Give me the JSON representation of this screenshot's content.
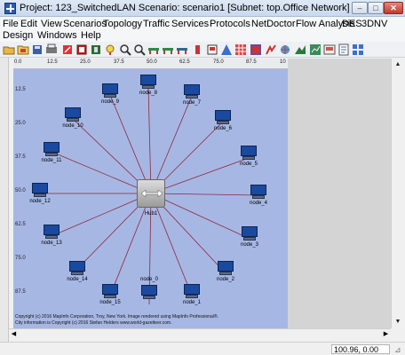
{
  "window": {
    "title": "Project: 123_SwitchedLAN Scenario: scenario1  [Subnet: top.Office Network]",
    "minimize_glyph": "–",
    "maximize_glyph": "□",
    "close_glyph": "✕"
  },
  "menu": {
    "items": [
      "File",
      "Edit",
      "View",
      "Scenarios",
      "Topology",
      "Traffic",
      "Services",
      "Protocols",
      "NetDoctor",
      "Flow Analysis",
      "DES",
      "3DNV",
      "Design",
      "Windows",
      "Help"
    ]
  },
  "toolbar": {
    "icons": [
      "open-folder-icon",
      "save-icon",
      "print-icon",
      "copy-icon",
      "stop-icon",
      "configure-icon",
      "marker-icon",
      "zoom-in-icon",
      "zoom-out-icon",
      "node-add-icon",
      "node-remove-icon",
      "link-icon",
      "marker-red-icon",
      "flag-icon",
      "warning-icon",
      "grid-icon",
      "tower-icon",
      "star-icon",
      "multicolor-icon",
      "color-icon",
      "chart-icon",
      "table-icon",
      "document-icon",
      "tile-icon"
    ]
  },
  "rulers": {
    "x_ticks": [
      "0.0",
      "12.5",
      "25.0",
      "37.5",
      "50.0",
      "62.5",
      "75.0",
      "87.5",
      "10"
    ],
    "y_ticks": [
      "12.5",
      "25.0",
      "37.5",
      "50.0",
      "62.5",
      "75.0",
      "87.5"
    ]
  },
  "network": {
    "hub_label": "Hub1",
    "nodes": [
      "node_8",
      "node_7",
      "node_6",
      "node_5",
      "node_4",
      "node_3",
      "node_2",
      "node_1",
      "node_0",
      "node_15",
      "node_14",
      "node_13",
      "node_12",
      "node_11",
      "node_10",
      "node_9"
    ],
    "colors": {
      "background": "#a7b7e4",
      "link": "#8b2a3a",
      "pc_screen": "#1a4aa0"
    }
  },
  "copyright": {
    "line1": "Copyright (c) 2016 MapInfo Corporation, Troy, New York. Image rendered using MapInfo Professional®.",
    "line2": "City information is Copyright (c) 2016 Stefan Helders www.world-gazetteer.com."
  },
  "status": {
    "coords": "100.96, 0.00"
  }
}
